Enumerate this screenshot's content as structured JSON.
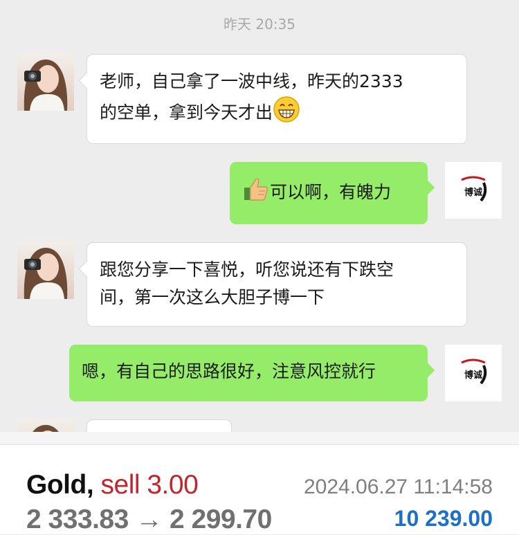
{
  "chat": {
    "timestamp": "昨天 20:35",
    "messages": [
      {
        "from": "student",
        "text": "老师，自己拿了一波中线，昨天的2333的空单，拿到今天才出",
        "line1": "老师，自己拿了一波中线，昨天的2333",
        "line2": "的空单，拿到今天才出",
        "emoji": "grinning-face-icon"
      },
      {
        "from": "teacher",
        "text": "可以啊，有魄力",
        "emoji": "thumbs-up-icon"
      },
      {
        "from": "student",
        "text": "跟您分享一下喜悦，听您说还有下跌空间，第一次这么大胆子博一下",
        "line1": "跟您分享一下喜悦，听您说还有下跌空",
        "line2": "间，第一次这么大胆子博一下"
      },
      {
        "from": "teacher",
        "text": "嗯，有自己的思路很好，注意风控就行"
      }
    ],
    "teacher_logo_text": "博诚"
  },
  "trade": {
    "symbol": "Gold,",
    "side": "sell 3.00",
    "prices": "2 333.83 → 2 299.70",
    "time": "2024.06.27 11:14:58",
    "profit": "10 239.00"
  },
  "colors": {
    "chat_bg": "#ededed",
    "bubble_self": "#95ec69",
    "bubble_other": "#ffffff",
    "sell_red": "#c0262d",
    "profit_blue": "#1e6fc6"
  }
}
